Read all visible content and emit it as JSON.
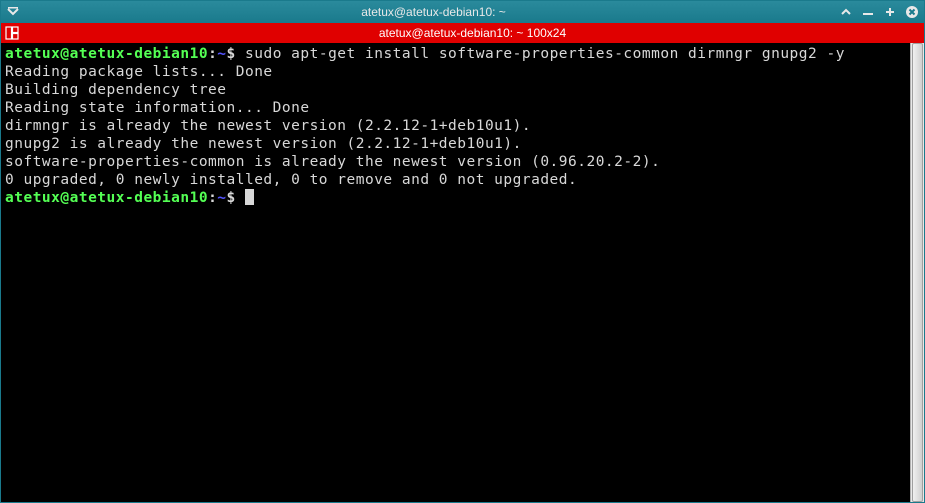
{
  "titlebar": {
    "title": "atetux@atetux-debian10: ~"
  },
  "tabbar": {
    "label": "atetux@atetux-debian10: ~ 100x24"
  },
  "prompt": {
    "user_host": "atetux@atetux-debian10",
    "colon": ":",
    "path": "~",
    "symbol": "$"
  },
  "command1": "sudo apt-get install software-properties-common dirmngr gnupg2 -y",
  "output": {
    "l1": "Reading package lists... Done",
    "l2": "Building dependency tree",
    "l3": "Reading state information... Done",
    "l4": "dirmngr is already the newest version (2.2.12-1+deb10u1).",
    "l5": "gnupg2 is already the newest version (2.2.12-1+deb10u1).",
    "l6": "software-properties-common is already the newest version (0.96.20.2-2).",
    "l7": "0 upgraded, 0 newly installed, 0 to remove and 0 not upgraded."
  }
}
